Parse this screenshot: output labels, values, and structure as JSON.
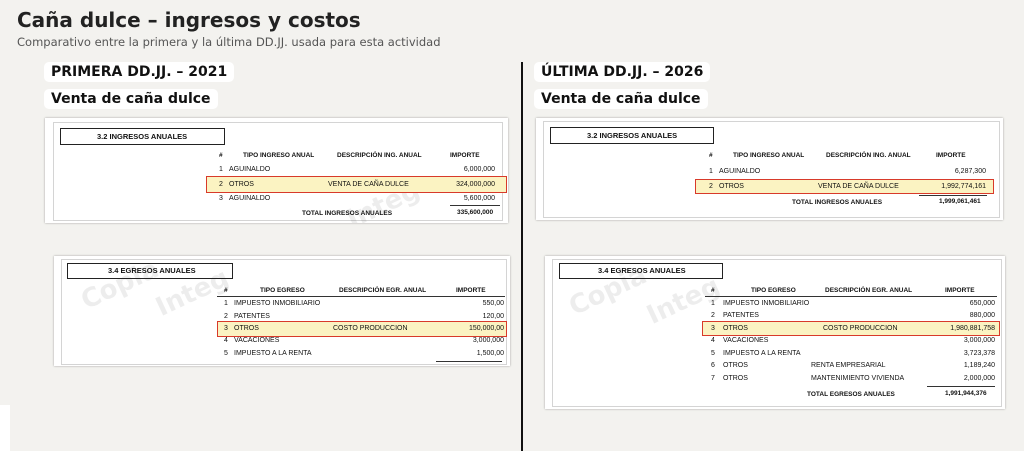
{
  "title": "Caña dulce – ingresos y costos",
  "subtitle": "Comparativo entre la primera y la última DD.JJ. usada para esta actividad",
  "watermark_a": "Copia",
  "watermark_b": "Integ",
  "left": {
    "period": "PRIMERA DD.JJ. – 2021",
    "activity": "Venta de caña dulce",
    "ingresos": {
      "section": "3.2 INGRESOS ANUALES",
      "headers": [
        "#",
        "TIPO INGRESO ANUAL",
        "DESCRIPCIÓN ING. ANUAL",
        "IMPORTE"
      ],
      "rows": [
        {
          "n": "1",
          "tipo": "AGUINALDO",
          "desc": "",
          "importe": "6,000,000"
        },
        {
          "n": "2",
          "tipo": "OTROS",
          "desc": "VENTA DE CAÑA DULCE",
          "importe": "324,000,000"
        },
        {
          "n": "3",
          "tipo": "AGUINALDO",
          "desc": "",
          "importe": "5,600,000"
        }
      ],
      "total_label": "TOTAL INGRESOS ANUALES",
      "total": "335,600,000"
    },
    "egresos": {
      "section": "3.4 EGRESOS ANUALES",
      "headers": [
        "#",
        "TIPO EGRESO",
        "DESCRIPCIÓN EGR. ANUAL",
        "IMPORTE"
      ],
      "rows": [
        {
          "n": "1",
          "tipo": "IMPUESTO INMOBILIARIO",
          "desc": "",
          "importe": "550,00"
        },
        {
          "n": "2",
          "tipo": "PATENTES",
          "desc": "",
          "importe": "120,00"
        },
        {
          "n": "3",
          "tipo": "OTROS",
          "desc": "COSTO PRODUCCION",
          "importe": "150,000,00"
        },
        {
          "n": "4",
          "tipo": "VACACIONES",
          "desc": "",
          "importe": "3,000,000"
        },
        {
          "n": "5",
          "tipo": "IMPUESTO A LA RENTA",
          "desc": "",
          "importe": "1,500,00"
        }
      ]
    }
  },
  "right": {
    "period": "ÚLTIMA DD.JJ. – 2026",
    "activity": "Venta de caña dulce",
    "ingresos": {
      "section": "3.2 INGRESOS ANUALES",
      "headers": [
        "#",
        "TIPO INGRESO ANUAL",
        "DESCRIPCIÓN ING. ANUAL",
        "IMPORTE"
      ],
      "rows": [
        {
          "n": "1",
          "tipo": "AGUINALDO",
          "desc": "",
          "importe": "6,287,300"
        },
        {
          "n": "2",
          "tipo": "OTROS",
          "desc": "VENTA DE CAÑA DULCE",
          "importe": "1,992,774,161"
        }
      ],
      "total_label": "TOTAL INGRESOS ANUALES",
      "total": "1,999,061,461"
    },
    "egresos": {
      "section": "3.4 EGRESOS ANUALES",
      "headers": [
        "#",
        "TIPO EGRESO",
        "DESCRIPCIÓN EGR. ANUAL",
        "IMPORTE"
      ],
      "rows": [
        {
          "n": "1",
          "tipo": "IMPUESTO INMOBILIARIO",
          "desc": "",
          "importe": "650,000"
        },
        {
          "n": "2",
          "tipo": "PATENTES",
          "desc": "",
          "importe": "880,000"
        },
        {
          "n": "3",
          "tipo": "OTROS",
          "desc": "COSTO PRODUCCION",
          "importe": "1,980,881,758"
        },
        {
          "n": "4",
          "tipo": "VACACIONES",
          "desc": "",
          "importe": "3,000,000"
        },
        {
          "n": "5",
          "tipo": "IMPUESTO A LA RENTA",
          "desc": "",
          "importe": "3,723,378"
        },
        {
          "n": "6",
          "tipo": "OTROS",
          "desc": "RENTA EMPRESARIAL",
          "importe": "1,189,240"
        },
        {
          "n": "7",
          "tipo": "OTROS",
          "desc": "MANTENIMIENTO VIVIENDA",
          "importe": "2,000,000"
        }
      ],
      "total_label": "TOTAL EGRESOS ANUALES",
      "total": "1,991,944,376"
    }
  }
}
